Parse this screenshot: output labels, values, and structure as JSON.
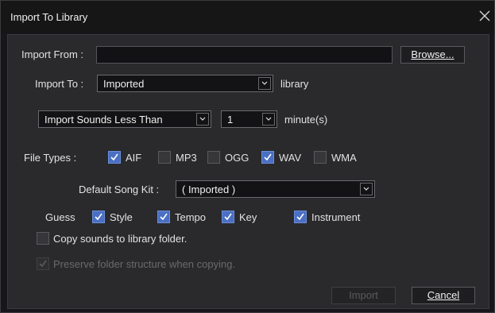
{
  "window": {
    "title": "Import To Library",
    "close_icon": "close-icon"
  },
  "import_from": {
    "label": "Import From :",
    "value": "",
    "browse_label": "Browse..."
  },
  "import_to": {
    "label": "Import To :",
    "selected": "Imported",
    "suffix": "library"
  },
  "size_filter": {
    "mode_selected": "Import Sounds Less Than",
    "minutes_selected": "1",
    "unit": "minute(s)"
  },
  "file_types": {
    "label": "File Types :",
    "items": [
      {
        "label": "AIF",
        "checked": true
      },
      {
        "label": "MP3",
        "checked": false
      },
      {
        "label": "OGG",
        "checked": false
      },
      {
        "label": "WAV",
        "checked": true
      },
      {
        "label": "WMA",
        "checked": false
      }
    ]
  },
  "song_kit": {
    "label": "Default Song Kit :",
    "selected": "( Imported )"
  },
  "guess": {
    "label": "Guess",
    "items": [
      {
        "label": "Style",
        "checked": true
      },
      {
        "label": "Tempo",
        "checked": true
      },
      {
        "label": "Key",
        "checked": true
      },
      {
        "label": "Instrument",
        "checked": true
      }
    ]
  },
  "options": {
    "copy_sounds": {
      "label": "Copy sounds to library folder.",
      "checked": false
    },
    "preserve_structure": {
      "label": "Preserve folder structure when copying.",
      "checked": true,
      "enabled": false
    }
  },
  "buttons": {
    "import_label": "Import",
    "cancel_label": "Cancel"
  },
  "colors": {
    "accent": "#4a6fc4",
    "background": "#2a2a2d",
    "titlebar": "#161617"
  }
}
